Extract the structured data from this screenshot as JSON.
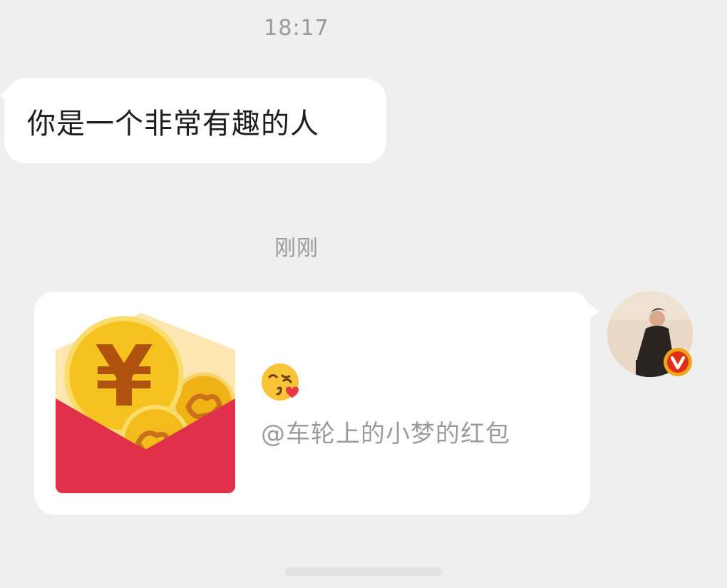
{
  "chat": {
    "timestamp_1": "18:17",
    "incoming_message": "你是一个非常有趣的人",
    "timestamp_2": "刚刚",
    "red_packet": {
      "emoji": "kiss-heart-emoji",
      "caption": "@车轮上的小梦的红包"
    },
    "sender_avatar": {
      "icon": "user-avatar",
      "badge_icon": "verified-v-badge"
    }
  },
  "colors": {
    "background": "#efeff0",
    "bubble": "#ffffff",
    "timestamp_text": "#9a9a9a",
    "envelope_red": "#e0304a",
    "envelope_back": "#fde6b0",
    "coin_gold": "#f3b81a",
    "badge_orange": "#f3a51a",
    "badge_red": "#e02e18"
  }
}
